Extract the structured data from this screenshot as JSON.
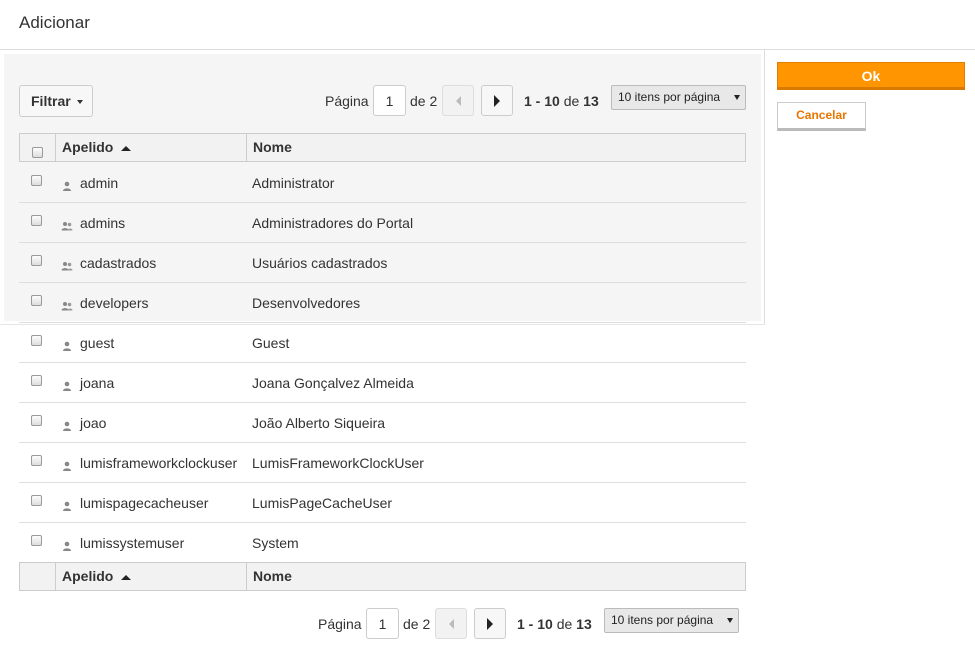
{
  "dialog": {
    "title": "Adicionar"
  },
  "actions": {
    "ok_label": "Ok",
    "cancel_label": "Cancelar"
  },
  "filter": {
    "label": "Filtrar"
  },
  "pagination": {
    "page_label": "Página",
    "page_value": "1",
    "of_label": "de 2",
    "range": "1 - 10",
    "range_of": "de",
    "total": "13",
    "page_size_label": "10 itens por página"
  },
  "table": {
    "columns": [
      "Apelido",
      "Nome"
    ],
    "rows": [
      {
        "apelido": "admin",
        "nome": "Administrator",
        "icon": "user-icon"
      },
      {
        "apelido": "admins",
        "nome": "Administradores do Portal",
        "icon": "group-icon"
      },
      {
        "apelido": "cadastrados",
        "nome": "Usuários cadastrados",
        "icon": "group-icon"
      },
      {
        "apelido": "developers",
        "nome": "Desenvolvedores",
        "icon": "group-icon"
      },
      {
        "apelido": "guest",
        "nome": "Guest",
        "icon": "user-icon"
      },
      {
        "apelido": "joana",
        "nome": "Joana Gonçalvez Almeida",
        "icon": "user-icon"
      },
      {
        "apelido": "joao",
        "nome": "João Alberto Siqueira",
        "icon": "user-icon"
      },
      {
        "apelido": "lumisframeworkclockuser",
        "nome": "LumisFrameworkClockUser",
        "icon": "user-icon"
      },
      {
        "apelido": "lumispagecacheuser",
        "nome": "LumisPageCacheUser",
        "icon": "user-icon"
      },
      {
        "apelido": "lumissystemuser",
        "nome": "System",
        "icon": "user-icon"
      }
    ]
  },
  "colors": {
    "accent": "#ff9500",
    "cancel_text": "#e87500"
  }
}
